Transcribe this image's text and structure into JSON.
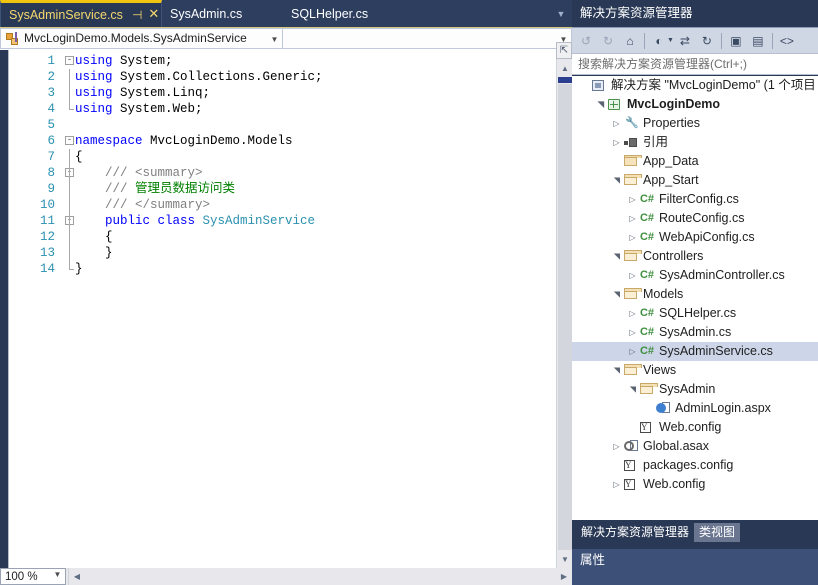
{
  "editor": {
    "tabs": [
      {
        "label": "SysAdminService.cs",
        "active": true,
        "pin_icon": "pin-icon",
        "close_icon": "close-icon"
      },
      {
        "label": "SysAdmin.cs",
        "active": false
      },
      {
        "label": "SQLHelper.cs",
        "active": false
      }
    ],
    "tab_overflow_icon": "chevron-down-icon",
    "nav": {
      "type_label": "MvcLoginDemo.Models.SysAdminService",
      "member_label": "",
      "type_icon": "class-icon",
      "dropdown_icon": "chevron-down-icon"
    },
    "code": {
      "lines": [
        {
          "num": "1",
          "fold": "-",
          "guide": "none",
          "tokens": [
            {
              "t": "using ",
              "c": "kw"
            },
            {
              "t": "System;",
              "c": "plain"
            }
          ]
        },
        {
          "num": "2",
          "fold": "",
          "guide": "full",
          "tokens": [
            {
              "t": "using ",
              "c": "kw"
            },
            {
              "t": "System.Collections.Generic;",
              "c": "plain"
            }
          ]
        },
        {
          "num": "3",
          "fold": "",
          "guide": "full",
          "tokens": [
            {
              "t": "using ",
              "c": "kw"
            },
            {
              "t": "System.Linq;",
              "c": "plain"
            }
          ]
        },
        {
          "num": "4",
          "fold": "",
          "guide": "corner",
          "tokens": [
            {
              "t": "using ",
              "c": "kw"
            },
            {
              "t": "System.Web;",
              "c": "plain"
            }
          ]
        },
        {
          "num": "5",
          "fold": "",
          "guide": "none",
          "tokens": []
        },
        {
          "num": "6",
          "fold": "-",
          "guide": "none",
          "tokens": [
            {
              "t": "namespace ",
              "c": "kw"
            },
            {
              "t": "MvcLoginDemo.Models",
              "c": "plain"
            }
          ]
        },
        {
          "num": "7",
          "fold": "",
          "guide": "full",
          "tokens": [
            {
              "t": "{",
              "c": "plain"
            }
          ]
        },
        {
          "num": "8",
          "fold": "-",
          "guide": "full",
          "tokens": [
            {
              "t": "    /// ",
              "c": "cmt"
            },
            {
              "t": "<summary>",
              "c": "cmt"
            }
          ]
        },
        {
          "num": "9",
          "fold": "",
          "guide": "full",
          "tokens": [
            {
              "t": "    /// ",
              "c": "cmt"
            },
            {
              "t": "管理员数据访问类",
              "c": "cmt-cn"
            }
          ]
        },
        {
          "num": "10",
          "fold": "",
          "guide": "full",
          "tokens": [
            {
              "t": "    /// ",
              "c": "cmt"
            },
            {
              "t": "</summary>",
              "c": "cmt"
            }
          ]
        },
        {
          "num": "11",
          "fold": "-",
          "guide": "full",
          "tokens": [
            {
              "t": "    public class ",
              "c": "kw"
            },
            {
              "t": "SysAdminService",
              "c": "typ"
            }
          ]
        },
        {
          "num": "12",
          "fold": "",
          "guide": "full",
          "tokens": [
            {
              "t": "    {",
              "c": "plain"
            }
          ]
        },
        {
          "num": "13",
          "fold": "",
          "guide": "full",
          "tokens": [
            {
              "t": "    }",
              "c": "plain"
            }
          ]
        },
        {
          "num": "14",
          "fold": "",
          "guide": "corner",
          "tokens": [
            {
              "t": "}",
              "c": "plain"
            }
          ]
        }
      ]
    },
    "scroll": {
      "split_icon": "split-editor-icon",
      "up_arrow_icon": "chevron-up-icon",
      "down_arrow_icon": "chevron-down-icon",
      "left_arrow_icon": "chevron-left-icon",
      "right_arrow_icon": "chevron-right-icon"
    },
    "status": {
      "zoom_value": "100 %",
      "zoom_dropdown_icon": "chevron-down-icon"
    }
  },
  "solution_explorer": {
    "title": "解决方案资源管理器",
    "toolbar": [
      {
        "name": "back-button",
        "glyph": "↺",
        "dim": true
      },
      {
        "name": "forward-button",
        "glyph": "↻",
        "dim": true
      },
      {
        "name": "home-button",
        "glyph": "⌂",
        "dim": false
      },
      {
        "name": "pending-changes-button",
        "glyph": "◐",
        "dim": false,
        "caret": true
      },
      {
        "name": "sync-with-editor-button",
        "glyph": "⇄",
        "dim": false
      },
      {
        "name": "refresh-button",
        "glyph": "↻",
        "dim": false
      },
      {
        "name": "collapse-all-button",
        "glyph": "▣",
        "dim": false
      },
      {
        "name": "show-all-files-button",
        "glyph": "▤",
        "dim": false
      },
      {
        "name": "view-code-button",
        "glyph": "<>",
        "dim": false
      }
    ],
    "search_placeholder": "搜索解决方案资源管理器(Ctrl+;)",
    "tree": [
      {
        "label": "解决方案 \"MvcLoginDemo\" (1 个项目",
        "indent": 0,
        "expander": "",
        "icon": "solution-icon",
        "bold": false,
        "selected": false
      },
      {
        "label": "MvcLoginDemo",
        "indent": 1,
        "expander": "▲",
        "icon": "project-icon",
        "bold": true,
        "selected": false
      },
      {
        "label": "Properties",
        "indent": 2,
        "expander": "▶",
        "icon": "properties-icon",
        "bold": false,
        "selected": false
      },
      {
        "label": "引用",
        "indent": 2,
        "expander": "▶",
        "icon": "references-icon",
        "bold": false,
        "selected": false
      },
      {
        "label": "App_Data",
        "indent": 2,
        "expander": "",
        "icon": "folder-icon",
        "bold": false,
        "selected": false
      },
      {
        "label": "App_Start",
        "indent": 2,
        "expander": "▲",
        "icon": "folder-open-icon",
        "bold": false,
        "selected": false
      },
      {
        "label": "FilterConfig.cs",
        "indent": 3,
        "expander": "▶",
        "icon": "csharp-file-icon",
        "bold": false,
        "selected": false
      },
      {
        "label": "RouteConfig.cs",
        "indent": 3,
        "expander": "▶",
        "icon": "csharp-file-icon",
        "bold": false,
        "selected": false
      },
      {
        "label": "WebApiConfig.cs",
        "indent": 3,
        "expander": "▶",
        "icon": "csharp-file-icon",
        "bold": false,
        "selected": false
      },
      {
        "label": "Controllers",
        "indent": 2,
        "expander": "▲",
        "icon": "folder-open-icon",
        "bold": false,
        "selected": false
      },
      {
        "label": "SysAdminController.cs",
        "indent": 3,
        "expander": "▶",
        "icon": "csharp-file-icon",
        "bold": false,
        "selected": false
      },
      {
        "label": "Models",
        "indent": 2,
        "expander": "▲",
        "icon": "folder-open-icon",
        "bold": false,
        "selected": false
      },
      {
        "label": "SQLHelper.cs",
        "indent": 3,
        "expander": "▶",
        "icon": "csharp-file-icon",
        "bold": false,
        "selected": false
      },
      {
        "label": "SysAdmin.cs",
        "indent": 3,
        "expander": "▶",
        "icon": "csharp-file-icon",
        "bold": false,
        "selected": false
      },
      {
        "label": "SysAdminService.cs",
        "indent": 3,
        "expander": "▶",
        "icon": "csharp-file-icon",
        "bold": false,
        "selected": true
      },
      {
        "label": "Views",
        "indent": 2,
        "expander": "▲",
        "icon": "folder-open-icon",
        "bold": false,
        "selected": false
      },
      {
        "label": "SysAdmin",
        "indent": 3,
        "expander": "▲",
        "icon": "folder-open-icon",
        "bold": false,
        "selected": false
      },
      {
        "label": "AdminLogin.aspx",
        "indent": 4,
        "expander": "",
        "icon": "aspx-file-icon",
        "bold": false,
        "selected": false
      },
      {
        "label": "Web.config",
        "indent": 3,
        "expander": "",
        "icon": "config-file-icon",
        "bold": false,
        "selected": false
      },
      {
        "label": "Global.asax",
        "indent": 2,
        "expander": "▶",
        "icon": "asax-file-icon",
        "bold": false,
        "selected": false
      },
      {
        "label": "packages.config",
        "indent": 2,
        "expander": "",
        "icon": "config-file-icon",
        "bold": false,
        "selected": false
      },
      {
        "label": "Web.config",
        "indent": 2,
        "expander": "▶",
        "icon": "config-file-icon",
        "bold": false,
        "selected": false
      }
    ],
    "bottom_tabs": [
      {
        "label": "解决方案资源管理器",
        "active": false
      },
      {
        "label": "类视图",
        "active": true
      }
    ],
    "properties_title": "属性"
  },
  "colors": {
    "chrome": "#293955",
    "accent_tab": "#f1c40f",
    "selection": "#cdd6e8",
    "keyword": "#0000ff",
    "type": "#2b91af",
    "comment": "#808080",
    "comment_cn": "#008000"
  }
}
